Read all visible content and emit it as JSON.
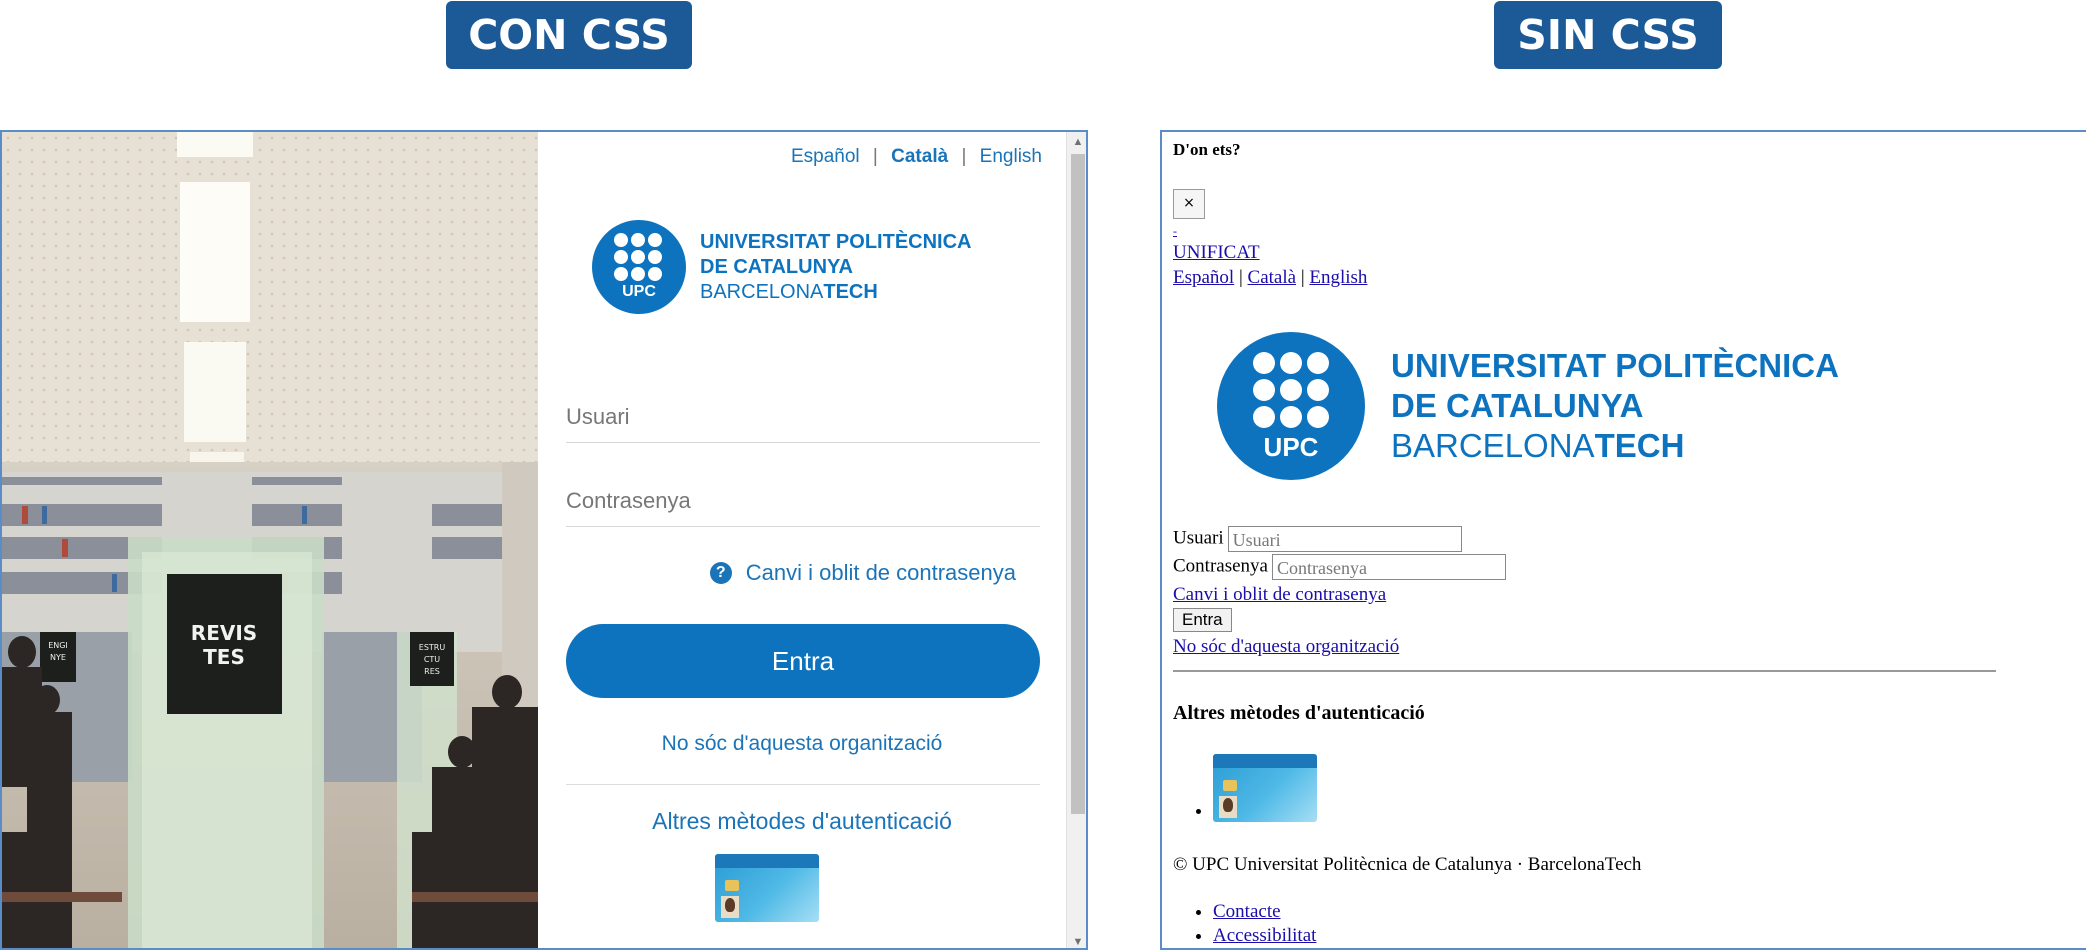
{
  "labels": {
    "left": "CON CSS",
    "right": "SIN CSS"
  },
  "photo": {
    "sign_main": "REVIS\nTES",
    "sign_left": "ENGI\nNYE\nRIA",
    "sign_right": "ESTRU\nCTU\nRES"
  },
  "lang": {
    "es": "Español",
    "ca": "Català",
    "en": "English",
    "sep": "|"
  },
  "logo": {
    "line1": "UNIVERSITAT POLITÈCNICA",
    "line2": "DE CATALUNYA",
    "line3_a": "BARCELONA",
    "line3_b": "TECH",
    "badge": "UPC"
  },
  "form": {
    "user_placeholder": "Usuari",
    "password_placeholder": "Contrasenya",
    "forgot": "Canvi i oblit de contrasenya",
    "submit": "Entra",
    "not_org": "No sóc d'aquesta organització",
    "alt_methods": "Altres mètodes d'autenticació"
  },
  "nocss": {
    "heading": "D'on ets?",
    "close": "×",
    "dash": "-",
    "unificat": "UNIFICAT",
    "user_label": "Usuari",
    "password_label": "Contrasenya",
    "forgot": "Canvi i oblit de contrasenya",
    "submit": "Entra",
    "not_org": "No sóc d'aquesta organització",
    "alt_methods": "Altres mètodes d'autenticació",
    "footer": "© UPC Universitat Politècnica de Catalunya · BarcelonaTech",
    "footer_links": [
      "Contacte",
      "Accessibilitat"
    ]
  },
  "colors": {
    "brand": "#0e73be",
    "label_bg": "#1b5a96",
    "link": "#1b74b8"
  }
}
